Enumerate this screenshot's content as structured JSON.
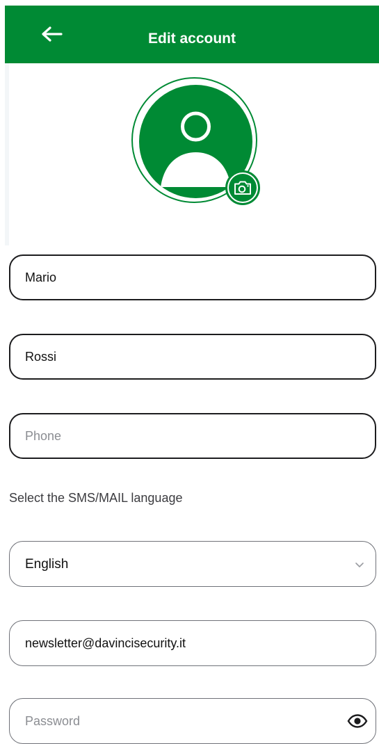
{
  "header": {
    "title": "Edit account",
    "back_icon": "arrow-left-icon",
    "background": "#008a34"
  },
  "avatar": {
    "icon": "user-icon",
    "camera_icon": "camera-icon",
    "accent": "#008a34"
  },
  "form": {
    "first_name": {
      "value": "Mario",
      "placeholder": ""
    },
    "last_name": {
      "value": "Rossi",
      "placeholder": ""
    },
    "phone": {
      "value": "",
      "placeholder": "Phone"
    },
    "language_label": "Select the SMS/MAIL language",
    "language": {
      "selected": "English",
      "chevron_icon": "chevron-down-icon"
    },
    "email": {
      "value": "newsletter@davincisecurity.it",
      "placeholder": ""
    },
    "password": {
      "value": "",
      "placeholder": "Password",
      "toggle_icon": "eye-icon"
    }
  }
}
